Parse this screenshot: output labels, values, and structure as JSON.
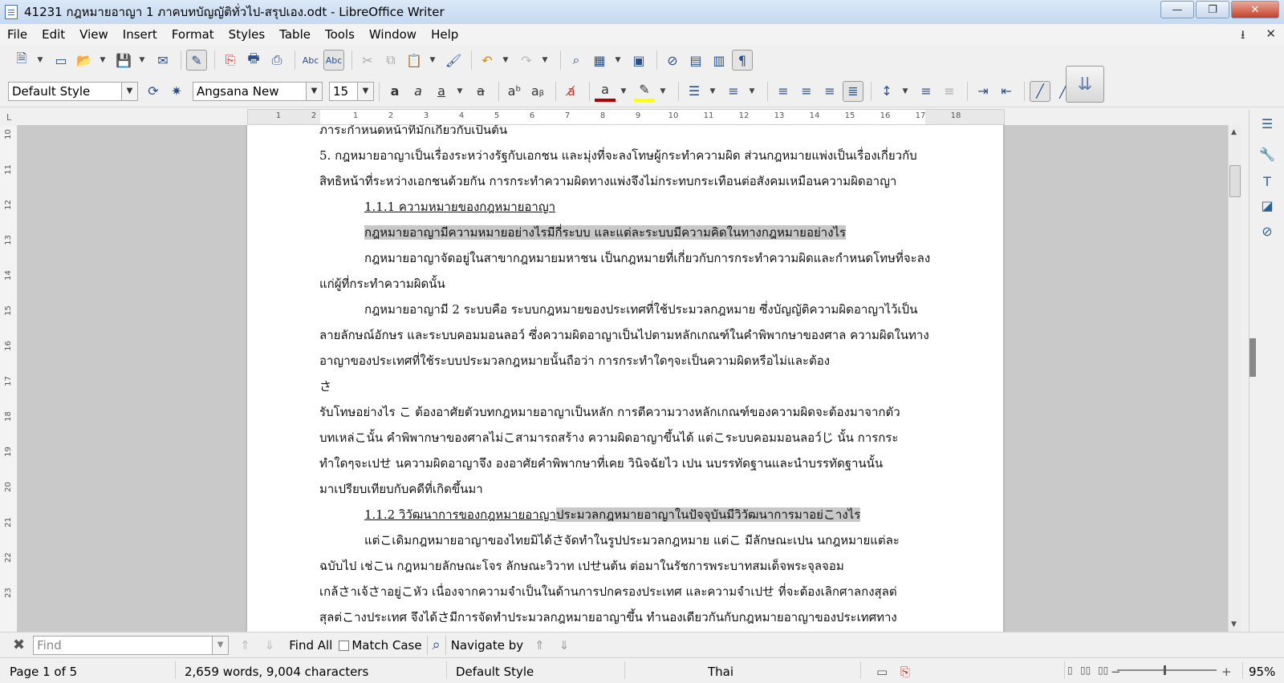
{
  "window": {
    "title": "41231 กฎหมายอาญา 1  ภาคบทบัญญัติทั่วไป-สรุปเอง.odt - LibreOffice Writer",
    "minimize": "—",
    "maximize": "❐",
    "close": "✕"
  },
  "menu": {
    "items": [
      "File",
      "Edit",
      "View",
      "Insert",
      "Format",
      "Styles",
      "Table",
      "Tools",
      "Window",
      "Help"
    ],
    "right_icons": [
      "⭳",
      "✕"
    ]
  },
  "toolbar2": {
    "paragraph_style": "Default Style",
    "font_name": "Angsana New",
    "font_size": "15"
  },
  "ruler": {
    "h_ticks": [
      "1",
      "2",
      "1",
      "2",
      "3",
      "4",
      "5",
      "6",
      "7",
      "8",
      "9",
      "10",
      "11",
      "12",
      "13",
      "14",
      "15",
      "16",
      "17",
      "18"
    ],
    "v_ticks": [
      "10",
      "11",
      "12",
      "13",
      "14",
      "15",
      "16",
      "17",
      "18",
      "19",
      "20",
      "21",
      "22",
      "23"
    ],
    "corner": "L"
  },
  "document": {
    "lines": [
      "ภาระกำหนดหน้าที่มักเกี่ยวกับเป็นต้น",
      "5. กฎหมายอาญาเป็นเรื่องระหว่างรัฐกับเอกชน และมุ่งที่จะลงโทษผู้กระทำความผิด ส่วนกฎหมายแพ่งเป็นเรื่องเกี่ยวกับ",
      "สิทธิหน้าที่ระหว่างเอกชนด้วยกัน การกระทำความผิดทางแพ่งจึงไม่กระทบกระเทือนต่อสังคมเหมือนความผิดอาญา",
      "1.1.1 ความหมายของกฎหมายอาญา",
      "กฎหมายอาญามีความหมายอย่างไรมีกี่ระบบ และแต่ละระบบมีความคิดในทางกฎหมายอย่างไร",
      "กฎหมายอาญาจัดอยู่ในสาขากฎหมายมหาชน เป็นกฎหมายที่เกี่ยวกับการกระทำความผิดและกำหนดโทษที่จะลง",
      "แก่ผู้ที่กระทำความผิดนั้น",
      "กฎหมายอาญามี 2 ระบบคือ ระบบกฎหมายของประเทศที่ใช้ประมวลกฎหมาย ซึ่งบัญญัติความผิดอาญาไว้เป็น",
      "ลายลักษณ์อักษร และระบบคอมมอนลอว์ ซึ่งความผิดอาญาเป็นไปตามหลักเกณฑ์ในคำพิพากษาของศาล ความผิดในทาง",
      "อาญาของประเทศที่ใช้ระบบประมวลกฎหมายนั้นถือว่า การกระทำใดๆจะเป็นความผิดหรือไม่และต้อง",
      "さ",
      "รับโทษอย่างไร こ      ต้องอาศัยตัวบทกฎหมายอาญาเป็นหลัก การตีความวางหลักเกณฑ์ของความผิดจะต้องมาจากตัว",
      "บทเหล่こนั้น คำพิพากษาของศาลไม่こสามารถสร้าง ความผิดอาญาขึ้นได้ แต่こระบบคอมมอนลอว์じ นั้น การกระ",
      "ทำใดๆจะเปせ    นความผิดอาญาจึง    องอาศัยคำพิพากษาที่เคย    วินิจฉัยไว    เปน    นบรรทัดฐานและนำบรรทัดฐานนั้น",
      "มาเปรียบเทียบกับคดีที่เกิดขึ้นมา",
      "1.1.2 วิวัฒนาการของกฎหมายอาญา",
      "ประมวลกฎหมายอาญาในปัจจุบันมีวิวัฒนาการมาอย่こางไร",
      "แต่こเดิมกฎหมายอาญาของไทยมิได้さจัดทำในรูปประมวลกฎหมาย แต่こ       มีลักษณะเปน    นกฎหมายแต่ละ",
      "ฉบับไป เช่こน กฎหมายลักษณะโจร ลักษณะวิวาท เปせนต้น ต่อมาในรัชการพระบาทสมเด็จพระจุลจอม",
      "เกล้さาเจ้さาอยู่こหัว เนื่องจากความจำเป็นในด้านการปกครองประเทศ และความจำเปせ      ที่จะต้องเลิกศาลกงสุลต่",
      "สุลต่こางประเทศ จึงได้さมีการจัดทำประมวลกฎหมายอาญาขึ้น ทำนองเดียวกันกับกฎหมายอาญาของประเทศทาง"
    ]
  },
  "findbar": {
    "placeholder": "Find",
    "find_all": "Find All",
    "match_case": "Match Case",
    "navigate_by": "Navigate by"
  },
  "status": {
    "page": "Page 1 of 5",
    "words": "2,659 words, 9,004 characters",
    "style": "Default Style",
    "language": "Thai",
    "zoom": "95%"
  },
  "colors": {
    "highlight": "#c8c8c8",
    "font_color_bar": "#b00000",
    "highlighter_bar": "#ffff00"
  }
}
